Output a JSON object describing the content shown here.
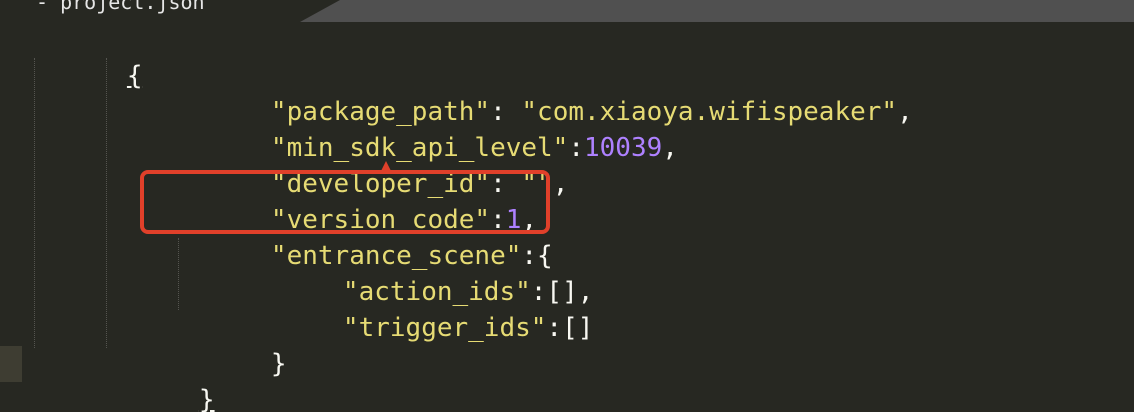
{
  "tab": {
    "title": "- project.json"
  },
  "code": {
    "open_brace": "{",
    "line1_key": "\"package_path\"",
    "line1_sep": ": ",
    "line1_val": "\"com.xiaoya.wifispeaker\"",
    "line1_end": ",",
    "line2_key": "\"min_sdk_api_level\"",
    "line2_sep": ":",
    "line2_val": "10039",
    "line2_end": ",",
    "line3_key": "\"developer_id\"",
    "line3_sep": ": ",
    "line3_val": "\"\"",
    "line3_end": ",",
    "line4_key": "\"version_code\"",
    "line4_sep": ":",
    "line4_val": "1",
    "line4_end": ",",
    "line5_key": "\"entrance_scene\"",
    "line5_sep": ":{",
    "line6_key": "\"action_ids\"",
    "line6_sep": ":[],",
    "line7_key": "\"trigger_ids\"",
    "line7_sep": ":[]",
    "inner_close": "}",
    "close_brace": "}"
  },
  "colors": {
    "background": "#272822",
    "string": "#e6db74",
    "number": "#ae81ff",
    "punctuation": "#f8f8f2",
    "annotation": "#e0402a"
  }
}
